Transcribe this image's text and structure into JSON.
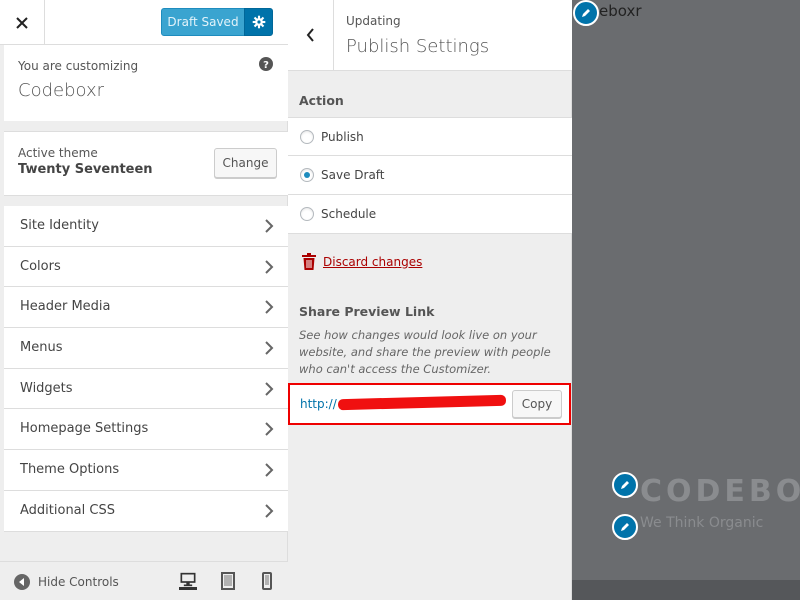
{
  "topbar": {
    "draft_label": "Draft Saved"
  },
  "info": {
    "pre": "You are customizing",
    "site_title": "Codeboxr"
  },
  "theme": {
    "pre": "Active theme",
    "name": "Twenty Seventeen",
    "change_label": "Change"
  },
  "menu": {
    "items": [
      {
        "label": "Site Identity"
      },
      {
        "label": "Colors"
      },
      {
        "label": "Header Media"
      },
      {
        "label": "Menus"
      },
      {
        "label": "Widgets"
      },
      {
        "label": "Homepage Settings"
      },
      {
        "label": "Theme Options"
      },
      {
        "label": "Additional CSS"
      }
    ]
  },
  "footer": {
    "hide_label": "Hide Controls"
  },
  "publish": {
    "pre": "Updating",
    "title": "Publish Settings",
    "action_title": "Action",
    "options": [
      {
        "label": "Publish",
        "selected": false
      },
      {
        "label": "Save Draft",
        "selected": true
      },
      {
        "label": "Schedule",
        "selected": false
      }
    ],
    "discard_label": "Discard changes",
    "share_title": "Share Preview Link",
    "share_desc": "See how changes would look live on your website, and share the preview with people who can't access the Customizer.",
    "url_prefix": "http://",
    "copy_label": "Copy"
  },
  "preview": {
    "top_text": "eboxr",
    "site_name": "CODEBO",
    "tagline": "We Think Organic"
  },
  "colors": {
    "accent": "#0073aa",
    "discard": "#aa0000",
    "highlight_border": "#ee0000"
  }
}
